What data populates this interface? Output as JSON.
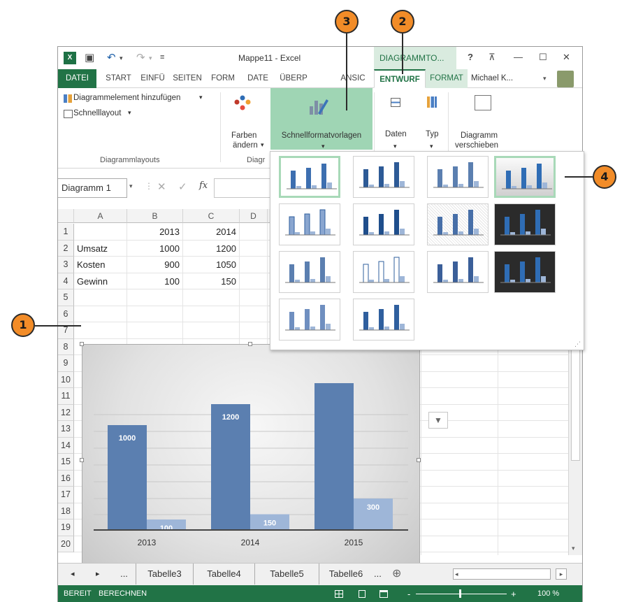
{
  "window": {
    "title": "Mappe11 - Excel",
    "context_header": "DIAGRAMMTO...",
    "help": "?",
    "user": "Michael K...",
    "user_caret": "▾"
  },
  "ribbon_tabs": [
    {
      "label": "DATEI"
    },
    {
      "label": "START"
    },
    {
      "label": "EINFÜ"
    },
    {
      "label": "SEITEN"
    },
    {
      "label": "FORM"
    },
    {
      "label": "DATE"
    },
    {
      "label": "ÜBERP"
    },
    {
      "label": "ANSIC"
    },
    {
      "label": "ENTWURF"
    },
    {
      "label": "FORMAT"
    }
  ],
  "ribbon": {
    "add_element": "Diagrammelement hinzufügen",
    "quick_layout": "Schnelllayout",
    "colors_line1": "Farben",
    "colors_line2": "ändern",
    "quick_styles": "Schnellformatvorlagen",
    "data": "Daten",
    "type": "Typ",
    "move_line1": "Diagramm",
    "move_line2": "verschieben",
    "group_layouts": "Diagrammlayouts",
    "group_styles": "Diagr"
  },
  "formula_bar": {
    "name_box": "Diagramm 1",
    "fx": "fx"
  },
  "columns": [
    "A",
    "B",
    "C",
    "D"
  ],
  "rows": [
    "1",
    "2",
    "3",
    "4",
    "5",
    "6",
    "7",
    "8",
    "9",
    "10",
    "11",
    "12",
    "13",
    "14",
    "15",
    "16",
    "17",
    "18",
    "19",
    "20"
  ],
  "cells": {
    "b1": "2013",
    "c1": "2014",
    "a2": "Umsatz",
    "b2": "1000",
    "c2": "1200",
    "a3": "Kosten",
    "b3": "900",
    "c3": "1050",
    "a4": "Gewinn",
    "b4": "100",
    "c4": "150"
  },
  "chart_data": {
    "type": "bar",
    "categories": [
      "2013",
      "2014",
      "2015"
    ],
    "series": [
      {
        "name": "Umsatz",
        "values": [
          1000,
          1200,
          1400
        ],
        "color": "#5b7fb0"
      },
      {
        "name": "Gewinn",
        "values": [
          100,
          150,
          300
        ],
        "color": "#9eb6d8"
      }
    ],
    "data_labels": [
      "1000",
      "100",
      "1200",
      "150",
      "300"
    ],
    "legend": "bottom",
    "ylim": [
      0,
      1400
    ]
  },
  "sheet_tabs": {
    "nav_prev": "◂",
    "nav_next": "▸",
    "ellipsis1": "...",
    "tabs": [
      "Tabelle3",
      "Tabelle4",
      "Tabelle5",
      "Tabelle6"
    ],
    "ellipsis2": "...",
    "add": "⊕"
  },
  "status": {
    "ready": "BEREIT",
    "calc": "BERECHNEN",
    "zoom": "100 %",
    "minus": "-",
    "plus": "+"
  },
  "callouts": [
    "1",
    "2",
    "3",
    "4"
  ]
}
